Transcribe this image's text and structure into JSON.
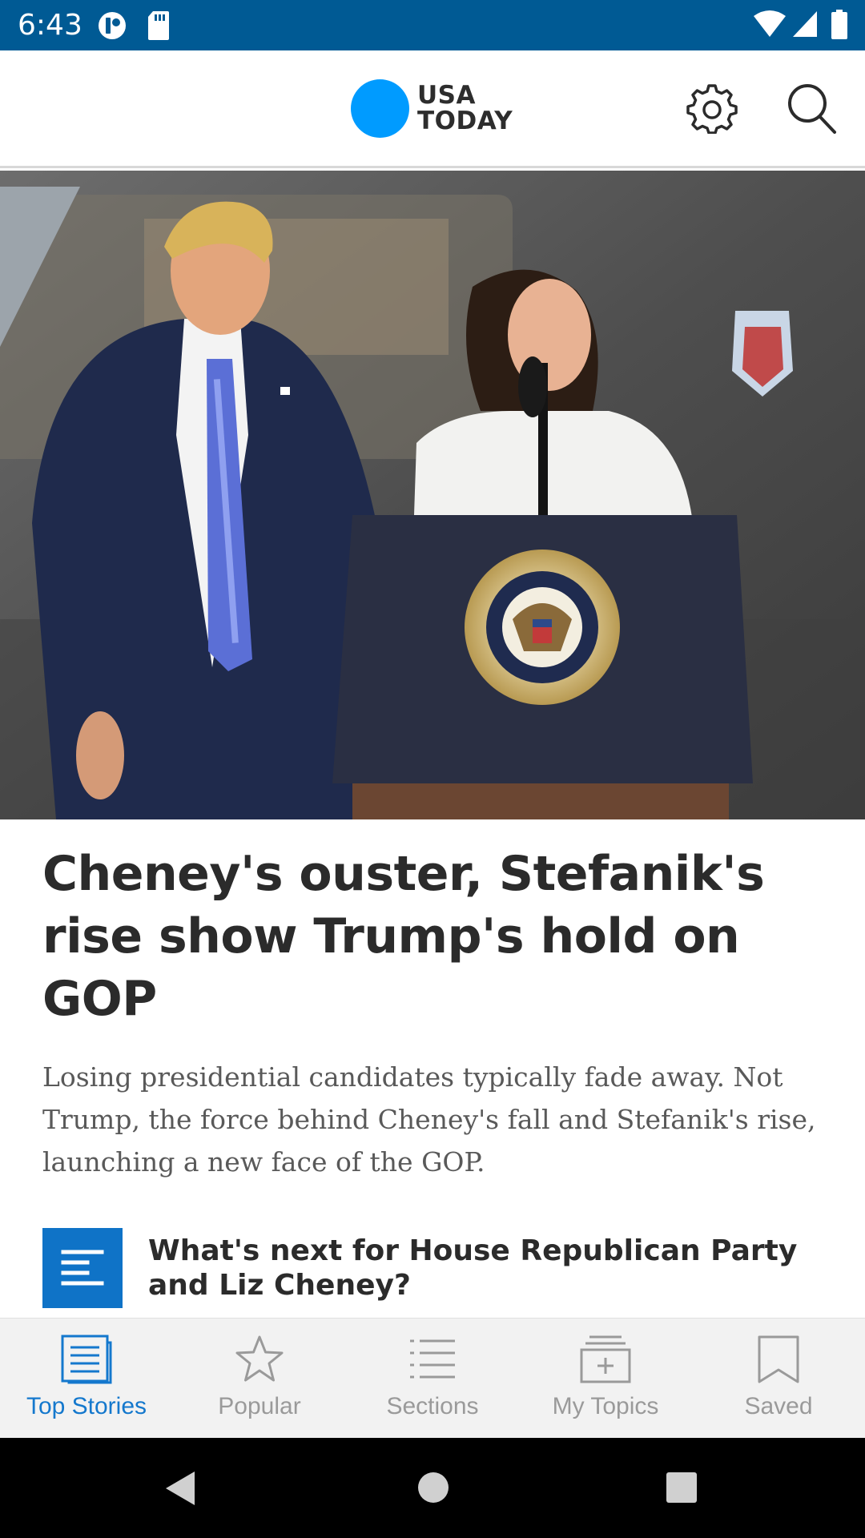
{
  "status_bar": {
    "time": "6:43",
    "icons": [
      "notification-icon",
      "sd-card-icon",
      "wifi-icon",
      "signal-icon",
      "battery-icon"
    ]
  },
  "app_bar": {
    "logo_line1": "USA",
    "logo_line2": "TODAY",
    "brand_color": "#009bff",
    "icons": [
      "settings-icon",
      "search-icon"
    ]
  },
  "article": {
    "headline": "Cheney's ouster, Stefanik's rise show Trump's hold on GOP",
    "summary": "Losing presidential candidates typically fade away. Not Trump, the force behind Cheney's fall and Stefanik's rise, launching a new face of the GOP.",
    "related_title": "What's next for House Republican Party and Liz Cheney?",
    "related_icon": "article-icon",
    "related_icon_color": "#0f73c7"
  },
  "tabs": [
    {
      "label": "Top Stories",
      "icon": "top-stories-icon",
      "active": true
    },
    {
      "label": "Popular",
      "icon": "star-icon",
      "active": false
    },
    {
      "label": "Sections",
      "icon": "list-icon",
      "active": false
    },
    {
      "label": "My Topics",
      "icon": "add-topic-icon",
      "active": false
    },
    {
      "label": "Saved",
      "icon": "bookmark-icon",
      "active": false
    }
  ],
  "colors": {
    "status_bar": "#005a94",
    "active_tab": "#1478cd",
    "inactive_tab": "#9a9a9a"
  },
  "nav_bar": {
    "icons": [
      "back-icon",
      "home-icon",
      "recents-icon"
    ]
  }
}
